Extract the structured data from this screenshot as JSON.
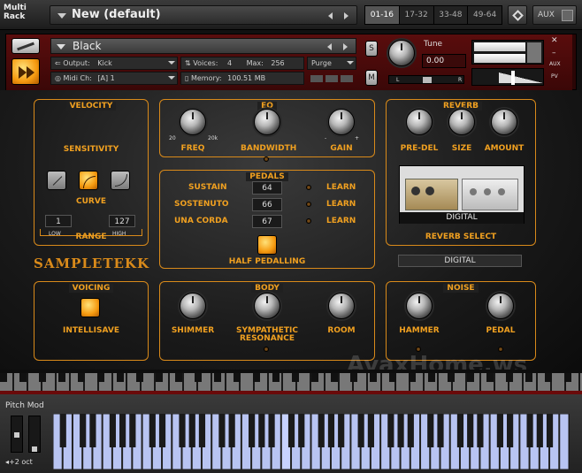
{
  "rack": {
    "label_line1": "Multi",
    "label_line2": "Rack",
    "preset_name": "New (default)",
    "page_tabs": [
      "01-16",
      "17-32",
      "33-48",
      "49-64"
    ],
    "selected_tab": "01-16",
    "aux_label": "AUX"
  },
  "instrument": {
    "name": "Black",
    "output_label": "Output:",
    "output_value": "Kick",
    "midi_label": "Midi Ch:",
    "midi_value": "[A] 1",
    "voices_label": "Voices:",
    "voices_value": "4",
    "max_label": "Max:",
    "max_value": "256",
    "purge_label": "Purge",
    "memory_label": "Memory:",
    "memory_value": "100.51 MB",
    "solo_label": "S",
    "mute_label": "M",
    "tune_label": "Tune",
    "tune_value": "0.00",
    "pan_left": "L",
    "pan_right": "R",
    "aux_label": "AUX",
    "pv_label": "PV"
  },
  "velocity": {
    "title": "VELOCITY",
    "sensitivity_label": "SENSITIVITY",
    "curve_label": "CURVE",
    "range_label": "RANGE",
    "low_value": "1",
    "low_label": "LOW",
    "high_value": "127",
    "high_label": "HIGH"
  },
  "eq": {
    "title": "EQ",
    "freq_label": "FREQ",
    "freq_min": "20",
    "freq_max": "20k",
    "bandwidth_label": "BANDWIDTH",
    "gain_label": "GAIN",
    "gain_minus": "-",
    "gain_plus": "+"
  },
  "pedals": {
    "title": "PEDALS",
    "rows": [
      {
        "name": "SUSTAIN",
        "value": "64",
        "learn": "LEARN"
      },
      {
        "name": "SOSTENUTO",
        "value": "66",
        "learn": "LEARN"
      },
      {
        "name": "UNA CORDA",
        "value": "67",
        "learn": "LEARN"
      }
    ],
    "half_pedalling_label": "HALF PEDALLING"
  },
  "reverb": {
    "title": "REVERB",
    "predel_label": "PRE-DEL",
    "size_label": "SIZE",
    "amount_label": "AMOUNT",
    "preview_label": "DIGITAL",
    "select_label": "REVERB SELECT",
    "select_value": "DIGITAL"
  },
  "brand": {
    "name": "SAMPLETEKK"
  },
  "voicing": {
    "title": "VOICING",
    "intellisave_label": "INTELLISAVE"
  },
  "body": {
    "title": "BODY",
    "shimmer_label": "SHIMMER",
    "sympathetic_label_1": "SYMPATHETIC",
    "sympathetic_label_2": "RESONANCE",
    "room_label": "ROOM"
  },
  "noise": {
    "title": "NOISE",
    "hammer_label": "HAMMER",
    "pedal_label": "PEDAL"
  },
  "watermark": "AvaxHome.ws",
  "keyboard": {
    "pitch_mod_label": "Pitch Mod",
    "octave_label": "+2 oct"
  },
  "colors": {
    "accent": "#f0a020",
    "header_red": "#5a0d0d"
  }
}
